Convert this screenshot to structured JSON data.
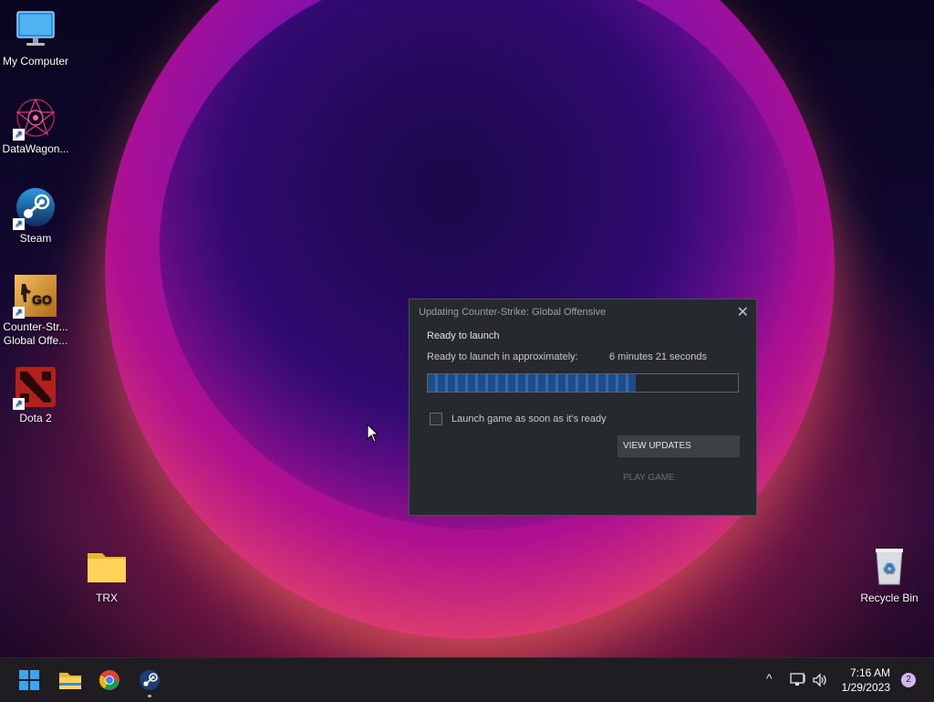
{
  "desktop": {
    "icons": [
      {
        "label": "My Computer"
      },
      {
        "label": "DataWagon..."
      },
      {
        "label": "Steam"
      },
      {
        "label": "Counter-Str... Global Offe..."
      },
      {
        "label": "Dota 2"
      },
      {
        "label": "TRX"
      },
      {
        "label": "Recycle Bin"
      }
    ]
  },
  "dialog": {
    "title": "Updating Counter-Strike: Global Offensive",
    "status": "Ready to launch",
    "eta_label": "Ready to launch in approximately:",
    "eta_value": "6 minutes 21 seconds",
    "progress_fraction": 0.67,
    "checkbox_label": "Launch game as soon as it's ready",
    "checkbox_checked": false,
    "view_updates_label": "VIEW UPDATES",
    "play_game_label": "PLAY GAME",
    "close_glyph": "✕"
  },
  "taskbar": {
    "pinned": [
      {
        "name": "start-icon"
      },
      {
        "name": "file-explorer-icon"
      },
      {
        "name": "chrome-icon"
      },
      {
        "name": "steam-icon"
      }
    ],
    "clock": {
      "time": "7:16 AM",
      "date": "1/29/2023"
    },
    "notification_count": "2"
  },
  "colors": {
    "dialog_bg": "#26292e",
    "progress_fill": "#2f6bb0",
    "taskbar_bg": "#1f1d22"
  }
}
